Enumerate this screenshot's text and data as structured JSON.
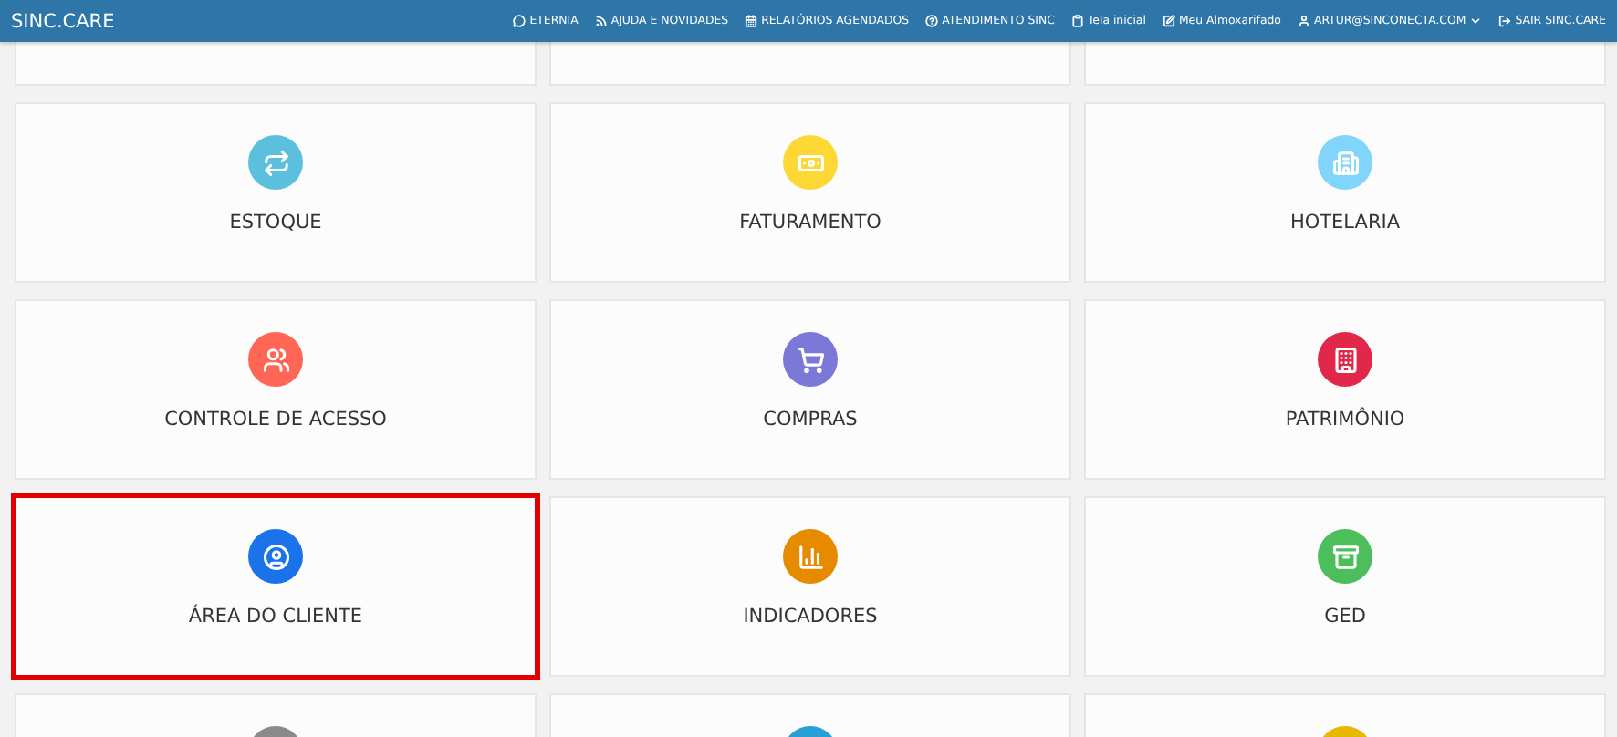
{
  "topbar": {
    "brand": "SINC.CARE",
    "links": [
      {
        "label": "ETERNIA",
        "dropdown": false
      },
      {
        "label": "AJUDA E NOVIDADES",
        "dropdown": false
      },
      {
        "label": "RELATÓRIOS AGENDADOS",
        "dropdown": false
      },
      {
        "label": "ATENDIMENTO SINC",
        "dropdown": false
      },
      {
        "label": "Tela inicial",
        "dropdown": false
      },
      {
        "label": "Meu Almoxarifado",
        "dropdown": false
      },
      {
        "label": "ARTUR@SINCONECTA.COM",
        "dropdown": true
      },
      {
        "label": "SAIR SINC.CARE",
        "dropdown": false
      }
    ]
  },
  "modules": [
    {
      "label": "ESTOQUE",
      "color": "#5bc0de",
      "highlighted": false
    },
    {
      "label": "FATURAMENTO",
      "color": "#fdd835",
      "highlighted": false
    },
    {
      "label": "HOTELARIA",
      "color": "#81d4fa",
      "highlighted": false
    },
    {
      "label": "CONTROLE DE ACESSO",
      "color": "#ff6655",
      "highlighted": false
    },
    {
      "label": "COMPRAS",
      "color": "#7b78d8",
      "highlighted": false
    },
    {
      "label": "PATRIMÔNIO",
      "color": "#e2284a",
      "highlighted": false
    },
    {
      "label": "ÁREA DO CLIENTE",
      "color": "#1a73e8",
      "highlighted": true
    },
    {
      "label": "INDICADORES",
      "color": "#e68a00",
      "highlighted": false
    },
    {
      "label": "GED",
      "color": "#4cbf5c",
      "highlighted": false
    }
  ],
  "next_row": [
    {
      "color": "#8a8a8a"
    },
    {
      "color": "#2a9fd6"
    },
    {
      "color": "#e6b800"
    }
  ]
}
